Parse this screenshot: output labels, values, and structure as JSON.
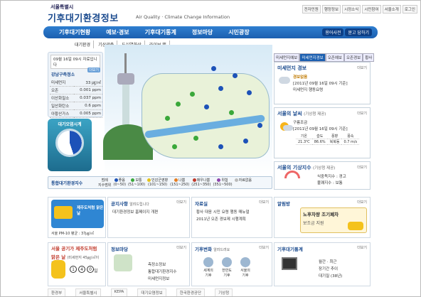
{
  "header": {
    "org": "서울특별시",
    "title": "기후대기환경정보",
    "subtitle": "Air Quality · Climate Change Information",
    "util_links": [
      "전자민원",
      "행정정보",
      "시정소식",
      "시민참여",
      "서울소개",
      "로그인"
    ]
  },
  "nav": {
    "items": [
      "기후대기현황",
      "예보·경보",
      "기후대기통계",
      "정보마당",
      "시민광장"
    ],
    "side": [
      "용어사전",
      "묻고 답하기"
    ],
    "sub": [
      "대기환경",
      "기상관측",
      "도심열화상",
      "라이브 맵"
    ]
  },
  "air": {
    "date": "09월 16일 09시 자료입니다",
    "station": "강남구측정소",
    "detail_btn": "더보기",
    "rows": [
      {
        "k": "미세먼지",
        "v": "33 ㎍/㎥"
      },
      {
        "k": "오존",
        "v": "0.001 ppm"
      },
      {
        "k": "이산화질소",
        "v": "0.037 ppm"
      },
      {
        "k": "일산화탄소",
        "v": "0.6 ppm"
      },
      {
        "k": "아황산가스",
        "v": "0.005 ppm"
      }
    ]
  },
  "gauge": {
    "title": "대기오염시계",
    "fill": 0.45
  },
  "legend": {
    "title": "통합대기환경지수",
    "items": [
      {
        "name": "좋음",
        "range": "(0~50)",
        "color": "#1d52b8"
      },
      {
        "name": "보통",
        "range": "(51~100)",
        "color": "#3aa83a"
      },
      {
        "name": "민감군영향",
        "range": "(101~150)",
        "color": "#e3c21a"
      },
      {
        "name": "나쁨",
        "range": "(151~250)",
        "color": "#e67e22"
      },
      {
        "name": "매우나쁨",
        "range": "(251~350)",
        "color": "#c0392b"
      },
      {
        "name": "위험",
        "range": "(351~500)",
        "color": "#8e44ad"
      },
      {
        "name": "자료없음",
        "range": "",
        "color": "#bbbbbb"
      }
    ],
    "prefix": [
      "범례",
      "지수범위"
    ]
  },
  "right_tabs": [
    "미세먼지예보",
    "미세먼지경보",
    "오존예보",
    "오존경보",
    "황사"
  ],
  "dust": {
    "title": "미세먼지 경보",
    "status": "경보없음",
    "time": "[2011년 09월 16일 09시 기준]",
    "detail": "미세먼지 행동요령",
    "more": "더보기"
  },
  "weather": {
    "title": "서울의 날씨",
    "note": "(기상청 제공)",
    "cond": "구름조금",
    "time": "[2011년 09월 16일 09시 기준]",
    "headers": [
      "기온",
      "습도",
      "풍향",
      "풍속"
    ],
    "values": [
      "21.3℃",
      "86.6%",
      "북북동",
      "0.7 m/s"
    ],
    "more": "더보기"
  },
  "index": {
    "title": "서울의 기상지수",
    "note": "(기상청 제공)",
    "l1": "식중독지수 : 경고",
    "l2": "불쾌지수 : 보통",
    "more": "더보기"
  },
  "notice": {
    "title": "공지사항",
    "more": "더보기",
    "link": "알려드립니다",
    "items": [
      "대기환경정보 홈페이지 개편"
    ]
  },
  "data_room": {
    "title": "자료실",
    "more": "더보기",
    "items": [
      "황사 대응 시민 요령 행동 매뉴얼",
      "2011년 오존 경보제 시행계획"
    ]
  },
  "alert": {
    "title": "알림방",
    "more": "더보기",
    "banner1": "노후차량 조기폐차",
    "banner2": "보조금 지원"
  },
  "pm": {
    "banner": "제주도처럼 맑은 날",
    "caption": "서울 PM-10 평균 : 37㎍/㎥"
  },
  "pm_goal": {
    "l1": "서울 공기가 제주도처럼",
    "l2": "맑은 날",
    "sub": "(미세먼지 45㎍/㎥이하)",
    "digits": [
      "1",
      "4",
      "0"
    ],
    "unit": "일"
  },
  "info": {
    "title": "정보마당",
    "more": "더보기",
    "items": [
      "측정소정보",
      "통합대기환경지수",
      "미세먼지정보"
    ]
  },
  "climate": {
    "title": "기후변화",
    "sub": "알려드려요",
    "more": "더보기",
    "icons": [
      "세계의 기후",
      "한반도 기후",
      "서울의 기후"
    ]
  },
  "stats": {
    "title": "기후대기통계",
    "more": "더보기",
    "items": [
      "월간 · 최근",
      "장기간 추이",
      "대기질 (38년)"
    ]
  },
  "footer": [
    "환경부",
    "서울특별시",
    "KEPA",
    "대기오염정보",
    "한국환경공단",
    "기상청"
  ]
}
